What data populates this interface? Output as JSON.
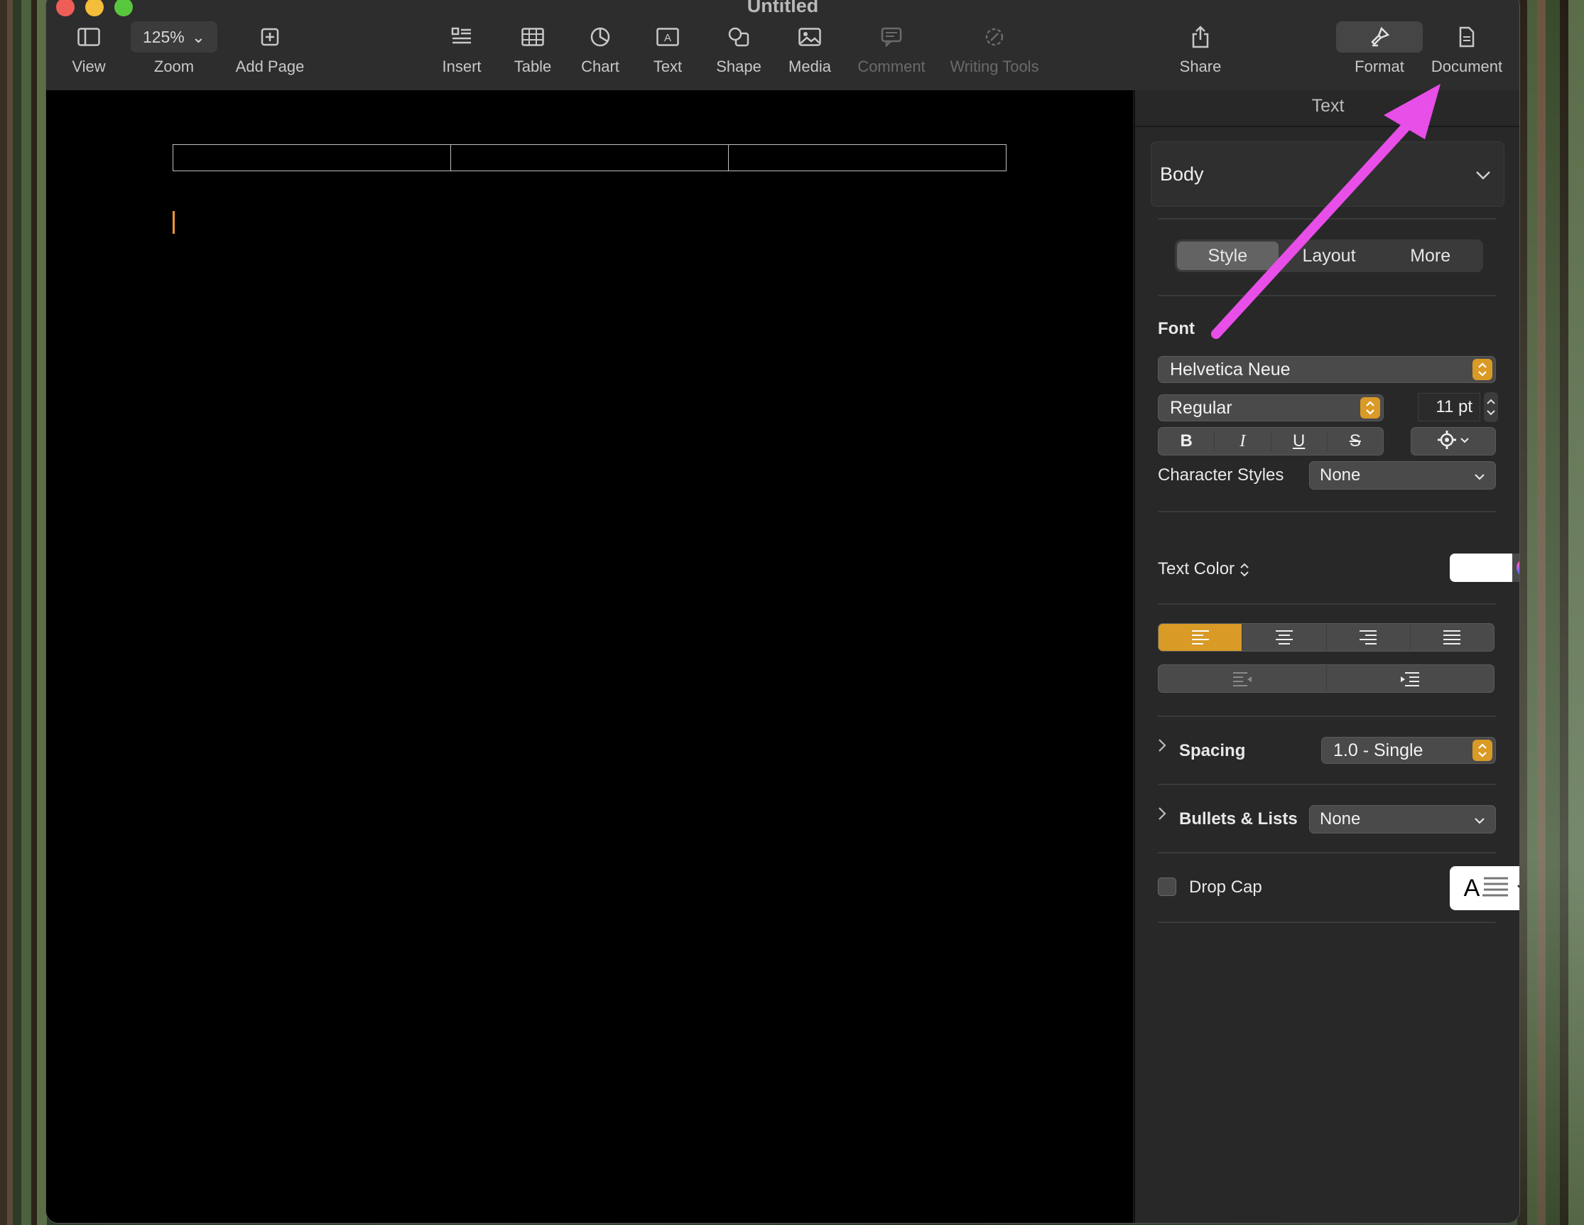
{
  "window": {
    "title": "Untitled"
  },
  "toolbar": {
    "view": "View",
    "zoom_value": "125%",
    "zoom": "Zoom",
    "add_page": "Add Page",
    "insert": "Insert",
    "table": "Table",
    "chart": "Chart",
    "text": "Text",
    "shape": "Shape",
    "media": "Media",
    "comment": "Comment",
    "writing_tools": "Writing Tools",
    "share": "Share",
    "format": "Format",
    "document": "Document"
  },
  "panel": {
    "title": "Text",
    "paragraph_style": "Body",
    "tabs": [
      "Style",
      "Layout",
      "More"
    ],
    "active_tab": "Style",
    "font_section": "Font",
    "font_family": "Helvetica Neue",
    "font_weight": "Regular",
    "font_size": "11 pt",
    "bold": "B",
    "italic": "I",
    "underline": "U",
    "strikethrough": "S",
    "character_styles_label": "Character Styles",
    "character_styles_value": "None",
    "text_color_label": "Text Color",
    "text_color": "#ffffff",
    "alignment_active": "left",
    "spacing_label": "Spacing",
    "spacing_value": "1.0 - Single",
    "bullets_label": "Bullets & Lists",
    "bullets_value": "None",
    "drop_cap_label": "Drop Cap",
    "drop_cap_checked": false,
    "drop_cap_letter": "A"
  },
  "document": {
    "table_columns": 3
  },
  "colors": {
    "accent": "#d99a26",
    "annotation_arrow": "#e84ee8",
    "caret": "#f0973a"
  }
}
